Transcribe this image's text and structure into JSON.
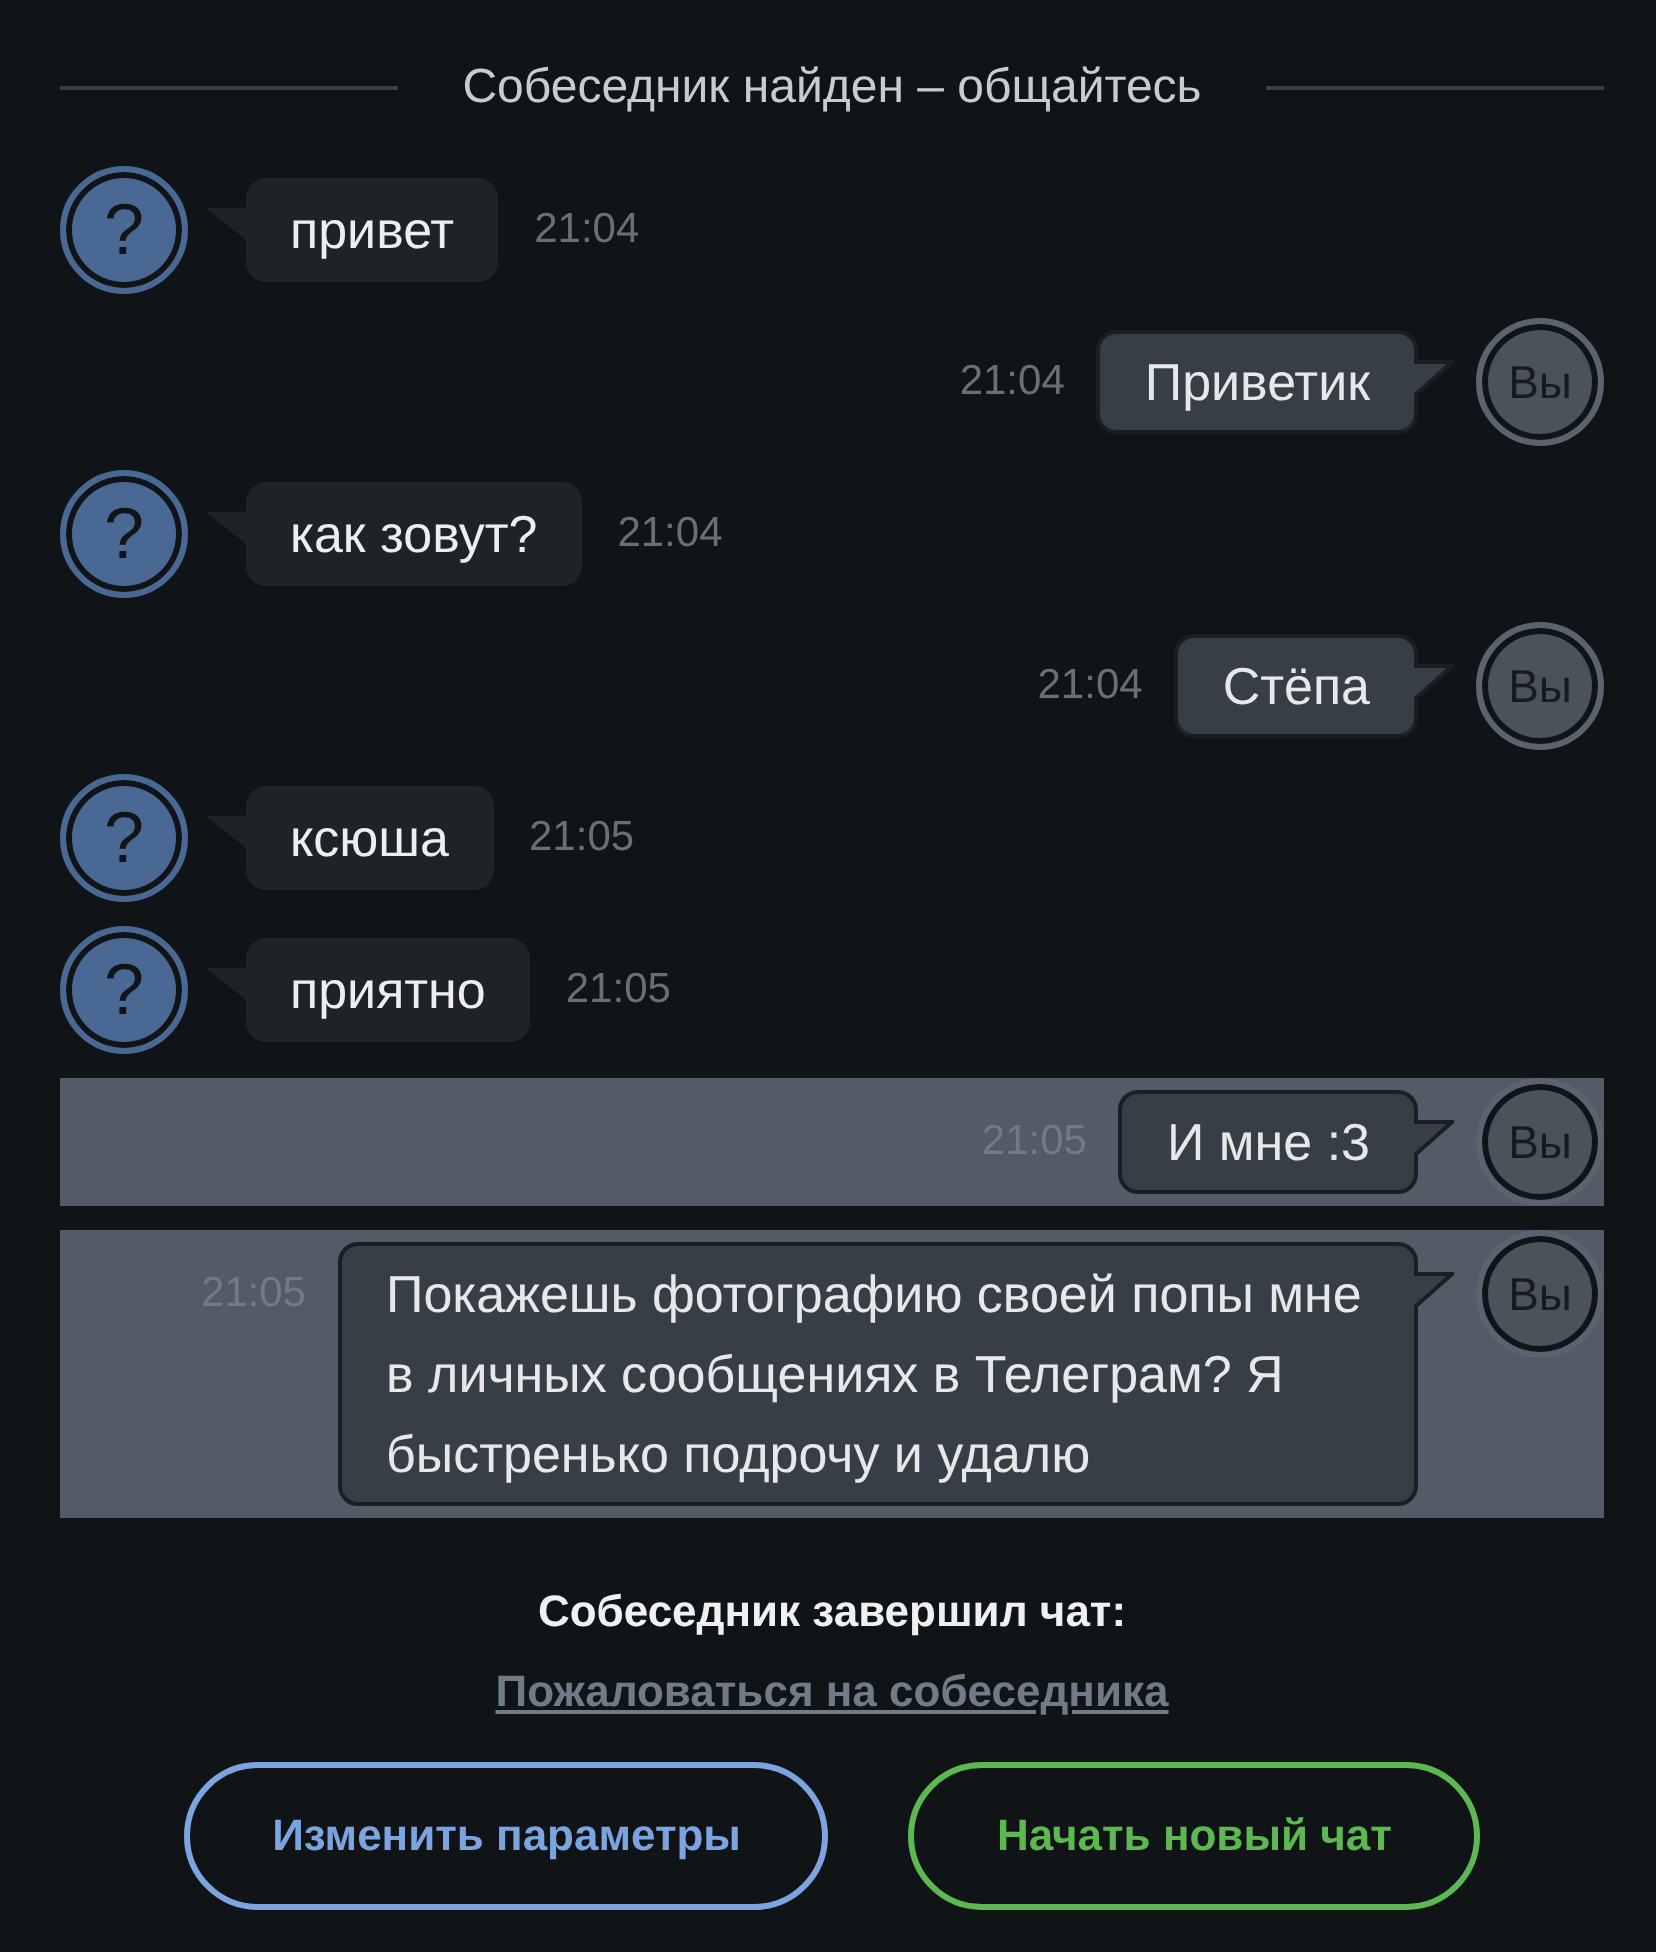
{
  "header": {
    "title": "Собеседник найден – общайтесь"
  },
  "messages": [
    {
      "kind": "incoming",
      "avatar": "?",
      "text": "привет",
      "time": "21:04",
      "selected": false
    },
    {
      "kind": "outgoing",
      "avatar": "Вы",
      "text": "Приветик",
      "time": "21:04",
      "selected": false
    },
    {
      "kind": "incoming",
      "avatar": "?",
      "text": "как зовут?",
      "time": "21:04",
      "selected": false
    },
    {
      "kind": "outgoing",
      "avatar": "Вы",
      "text": "Стёпа",
      "time": "21:04",
      "selected": false
    },
    {
      "kind": "incoming",
      "avatar": "?",
      "text": "ксюша",
      "time": "21:05",
      "selected": false
    },
    {
      "kind": "incoming",
      "avatar": "?",
      "text": "приятно",
      "time": "21:05",
      "selected": false
    },
    {
      "kind": "outgoing",
      "avatar": "Вы",
      "text": "И мне :3",
      "time": "21:05",
      "selected": true
    },
    {
      "kind": "outgoing",
      "avatar": "Вы",
      "text": "Покажешь фотографию своей попы мне в личных сообщениях в Телеграм? Я быстренько подрочу и удалю",
      "time": "21:05",
      "selected": true
    }
  ],
  "end_notice": {
    "text": "Собеседник завершил чат:",
    "report_link": "Пожаловаться на собеседника"
  },
  "buttons": [
    {
      "label": "Изменить параметры",
      "color": "#7ba4e0"
    },
    {
      "label": "Начать новый чат",
      "color": "#5db851"
    }
  ]
}
